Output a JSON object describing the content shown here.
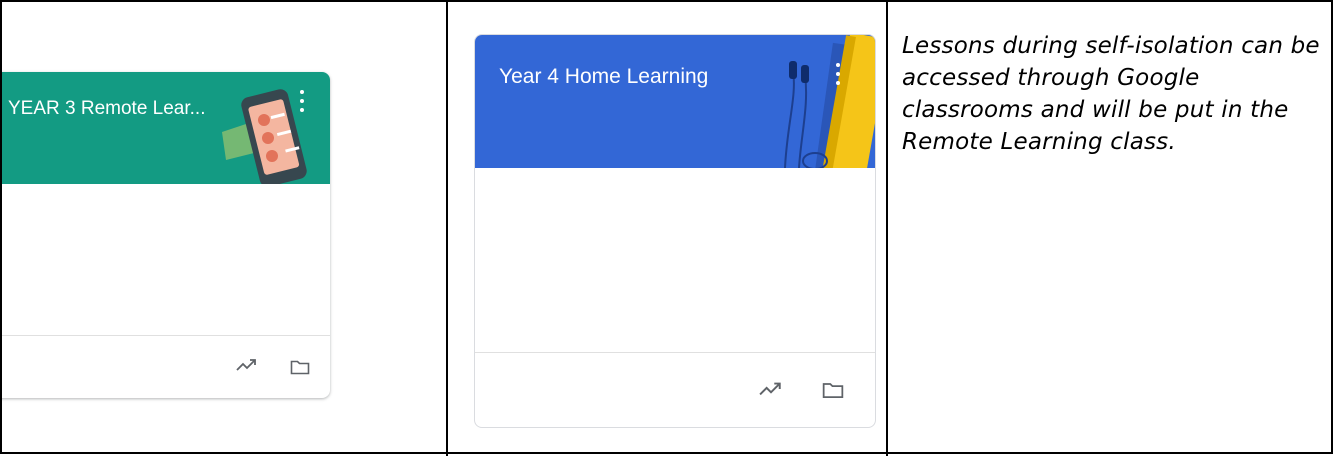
{
  "cards": [
    {
      "title": "YEAR 3 Remote Lear...",
      "header_color": "#139b83",
      "header_illustration": "phone-with-avatars",
      "icons": [
        "more-vert-icon",
        "trending-up-icon",
        "folder-icon"
      ]
    },
    {
      "title": "Year 4 Home Learning",
      "header_color": "#3367d6",
      "header_illustration": "books-and-headphones",
      "icons": [
        "more-vert-icon",
        "trending-up-icon",
        "folder-icon"
      ]
    }
  ],
  "note": {
    "text": "Lessons during self-isolation can be accessed through Google classrooms and will be put in the Remote Learning class."
  }
}
